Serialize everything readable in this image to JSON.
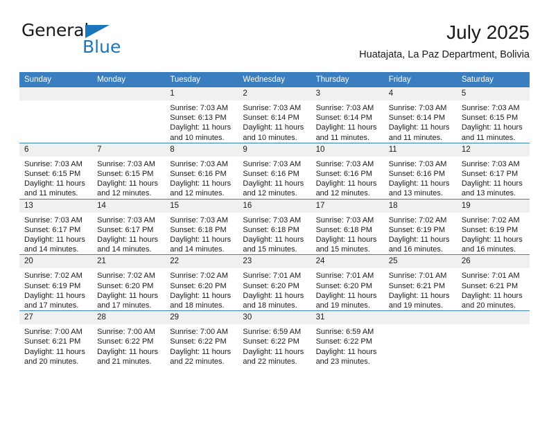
{
  "logo": {
    "word1": "General",
    "word2": "Blue",
    "triangle_color": "#1b75bb",
    "text_color": "#1a1a1a"
  },
  "header": {
    "title": "July 2025",
    "subtitle": "Huatajata, La Paz Department, Bolivia"
  },
  "theme": {
    "header_bg": "#3a7ebf",
    "header_text": "#ffffff",
    "daynum_bg": "#f0f0f0",
    "cell_bg": "#ffffff",
    "grid_line": "#3a7ebf"
  },
  "calendar": {
    "weekday_headers": [
      "Sunday",
      "Monday",
      "Tuesday",
      "Wednesday",
      "Thursday",
      "Friday",
      "Saturday"
    ],
    "weeks": [
      [
        {
          "day": "",
          "empty": true
        },
        {
          "day": "",
          "empty": true
        },
        {
          "day": "1",
          "sunrise": "Sunrise: 7:03 AM",
          "sunset": "Sunset: 6:13 PM",
          "daylight_line1": "Daylight: 11 hours",
          "daylight_line2": "and 10 minutes."
        },
        {
          "day": "2",
          "sunrise": "Sunrise: 7:03 AM",
          "sunset": "Sunset: 6:14 PM",
          "daylight_line1": "Daylight: 11 hours",
          "daylight_line2": "and 10 minutes."
        },
        {
          "day": "3",
          "sunrise": "Sunrise: 7:03 AM",
          "sunset": "Sunset: 6:14 PM",
          "daylight_line1": "Daylight: 11 hours",
          "daylight_line2": "and 11 minutes."
        },
        {
          "day": "4",
          "sunrise": "Sunrise: 7:03 AM",
          "sunset": "Sunset: 6:14 PM",
          "daylight_line1": "Daylight: 11 hours",
          "daylight_line2": "and 11 minutes."
        },
        {
          "day": "5",
          "sunrise": "Sunrise: 7:03 AM",
          "sunset": "Sunset: 6:15 PM",
          "daylight_line1": "Daylight: 11 hours",
          "daylight_line2": "and 11 minutes."
        }
      ],
      [
        {
          "day": "6",
          "sunrise": "Sunrise: 7:03 AM",
          "sunset": "Sunset: 6:15 PM",
          "daylight_line1": "Daylight: 11 hours",
          "daylight_line2": "and 11 minutes."
        },
        {
          "day": "7",
          "sunrise": "Sunrise: 7:03 AM",
          "sunset": "Sunset: 6:15 PM",
          "daylight_line1": "Daylight: 11 hours",
          "daylight_line2": "and 12 minutes."
        },
        {
          "day": "8",
          "sunrise": "Sunrise: 7:03 AM",
          "sunset": "Sunset: 6:16 PM",
          "daylight_line1": "Daylight: 11 hours",
          "daylight_line2": "and 12 minutes."
        },
        {
          "day": "9",
          "sunrise": "Sunrise: 7:03 AM",
          "sunset": "Sunset: 6:16 PM",
          "daylight_line1": "Daylight: 11 hours",
          "daylight_line2": "and 12 minutes."
        },
        {
          "day": "10",
          "sunrise": "Sunrise: 7:03 AM",
          "sunset": "Sunset: 6:16 PM",
          "daylight_line1": "Daylight: 11 hours",
          "daylight_line2": "and 12 minutes."
        },
        {
          "day": "11",
          "sunrise": "Sunrise: 7:03 AM",
          "sunset": "Sunset: 6:16 PM",
          "daylight_line1": "Daylight: 11 hours",
          "daylight_line2": "and 13 minutes."
        },
        {
          "day": "12",
          "sunrise": "Sunrise: 7:03 AM",
          "sunset": "Sunset: 6:17 PM",
          "daylight_line1": "Daylight: 11 hours",
          "daylight_line2": "and 13 minutes."
        }
      ],
      [
        {
          "day": "13",
          "sunrise": "Sunrise: 7:03 AM",
          "sunset": "Sunset: 6:17 PM",
          "daylight_line1": "Daylight: 11 hours",
          "daylight_line2": "and 14 minutes."
        },
        {
          "day": "14",
          "sunrise": "Sunrise: 7:03 AM",
          "sunset": "Sunset: 6:17 PM",
          "daylight_line1": "Daylight: 11 hours",
          "daylight_line2": "and 14 minutes."
        },
        {
          "day": "15",
          "sunrise": "Sunrise: 7:03 AM",
          "sunset": "Sunset: 6:18 PM",
          "daylight_line1": "Daylight: 11 hours",
          "daylight_line2": "and 14 minutes."
        },
        {
          "day": "16",
          "sunrise": "Sunrise: 7:03 AM",
          "sunset": "Sunset: 6:18 PM",
          "daylight_line1": "Daylight: 11 hours",
          "daylight_line2": "and 15 minutes."
        },
        {
          "day": "17",
          "sunrise": "Sunrise: 7:03 AM",
          "sunset": "Sunset: 6:18 PM",
          "daylight_line1": "Daylight: 11 hours",
          "daylight_line2": "and 15 minutes."
        },
        {
          "day": "18",
          "sunrise": "Sunrise: 7:02 AM",
          "sunset": "Sunset: 6:19 PM",
          "daylight_line1": "Daylight: 11 hours",
          "daylight_line2": "and 16 minutes."
        },
        {
          "day": "19",
          "sunrise": "Sunrise: 7:02 AM",
          "sunset": "Sunset: 6:19 PM",
          "daylight_line1": "Daylight: 11 hours",
          "daylight_line2": "and 16 minutes."
        }
      ],
      [
        {
          "day": "20",
          "sunrise": "Sunrise: 7:02 AM",
          "sunset": "Sunset: 6:19 PM",
          "daylight_line1": "Daylight: 11 hours",
          "daylight_line2": "and 17 minutes."
        },
        {
          "day": "21",
          "sunrise": "Sunrise: 7:02 AM",
          "sunset": "Sunset: 6:20 PM",
          "daylight_line1": "Daylight: 11 hours",
          "daylight_line2": "and 17 minutes."
        },
        {
          "day": "22",
          "sunrise": "Sunrise: 7:02 AM",
          "sunset": "Sunset: 6:20 PM",
          "daylight_line1": "Daylight: 11 hours",
          "daylight_line2": "and 18 minutes."
        },
        {
          "day": "23",
          "sunrise": "Sunrise: 7:01 AM",
          "sunset": "Sunset: 6:20 PM",
          "daylight_line1": "Daylight: 11 hours",
          "daylight_line2": "and 18 minutes."
        },
        {
          "day": "24",
          "sunrise": "Sunrise: 7:01 AM",
          "sunset": "Sunset: 6:20 PM",
          "daylight_line1": "Daylight: 11 hours",
          "daylight_line2": "and 19 minutes."
        },
        {
          "day": "25",
          "sunrise": "Sunrise: 7:01 AM",
          "sunset": "Sunset: 6:21 PM",
          "daylight_line1": "Daylight: 11 hours",
          "daylight_line2": "and 19 minutes."
        },
        {
          "day": "26",
          "sunrise": "Sunrise: 7:01 AM",
          "sunset": "Sunset: 6:21 PM",
          "daylight_line1": "Daylight: 11 hours",
          "daylight_line2": "and 20 minutes."
        }
      ],
      [
        {
          "day": "27",
          "sunrise": "Sunrise: 7:00 AM",
          "sunset": "Sunset: 6:21 PM",
          "daylight_line1": "Daylight: 11 hours",
          "daylight_line2": "and 20 minutes."
        },
        {
          "day": "28",
          "sunrise": "Sunrise: 7:00 AM",
          "sunset": "Sunset: 6:22 PM",
          "daylight_line1": "Daylight: 11 hours",
          "daylight_line2": "and 21 minutes."
        },
        {
          "day": "29",
          "sunrise": "Sunrise: 7:00 AM",
          "sunset": "Sunset: 6:22 PM",
          "daylight_line1": "Daylight: 11 hours",
          "daylight_line2": "and 22 minutes."
        },
        {
          "day": "30",
          "sunrise": "Sunrise: 6:59 AM",
          "sunset": "Sunset: 6:22 PM",
          "daylight_line1": "Daylight: 11 hours",
          "daylight_line2": "and 22 minutes."
        },
        {
          "day": "31",
          "sunrise": "Sunrise: 6:59 AM",
          "sunset": "Sunset: 6:22 PM",
          "daylight_line1": "Daylight: 11 hours",
          "daylight_line2": "and 23 minutes."
        },
        {
          "day": "",
          "empty": true
        },
        {
          "day": "",
          "empty": true
        }
      ]
    ]
  }
}
